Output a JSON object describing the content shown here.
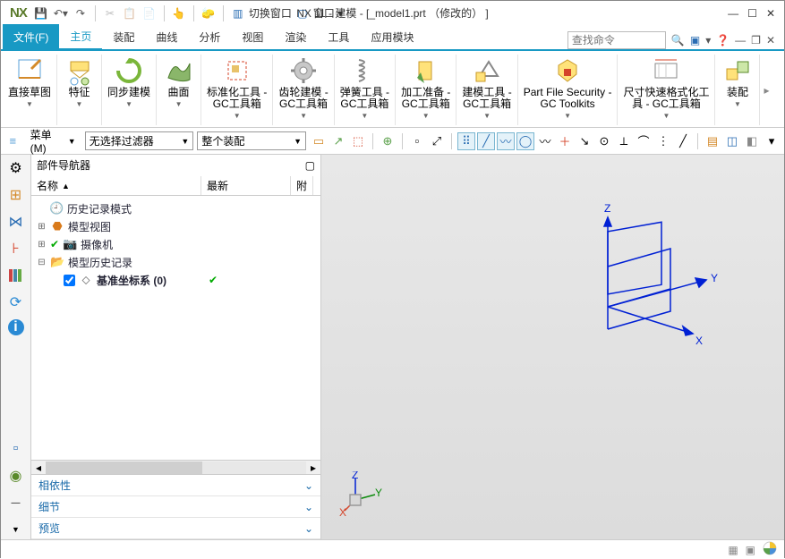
{
  "app": {
    "logo": "NX",
    "title": "NX 11 -  建模 - [_model1.prt （修改的） ]"
  },
  "titlebar_tools": {
    "switch_window": "切换窗口",
    "window_menu": "窗口"
  },
  "ribbon": {
    "file_tab": "文件(F)",
    "tabs": [
      "主页",
      "装配",
      "曲线",
      "分析",
      "视图",
      "渲染",
      "工具",
      "应用模块"
    ],
    "active_tab_index": 0,
    "search_placeholder": "查找命令",
    "groups": [
      {
        "label": "直接草图",
        "sub": ""
      },
      {
        "label": "特征",
        "sub": ""
      },
      {
        "label": "同步建模",
        "sub": ""
      },
      {
        "label": "曲面",
        "sub": ""
      },
      {
        "label": "标准化工具 -",
        "sub": "GC工具箱"
      },
      {
        "label": "齿轮建模 -",
        "sub": "GC工具箱"
      },
      {
        "label": "弹簧工具 -",
        "sub": "GC工具箱"
      },
      {
        "label": "加工准备 -",
        "sub": "GC工具箱"
      },
      {
        "label": "建模工具 -",
        "sub": "GC工具箱"
      },
      {
        "label": "Part File Security -",
        "sub": "GC Toolkits"
      },
      {
        "label": "尺寸快速格式化工",
        "sub": "具 - GC工具箱"
      },
      {
        "label": "装配",
        "sub": ""
      }
    ]
  },
  "toolbar2": {
    "menu_label": "菜单(M)",
    "filter_combo": "无选择过滤器",
    "assembly_combo": "整个装配"
  },
  "navigator": {
    "title": "部件导航器",
    "columns": {
      "name": "名称",
      "latest": "最新",
      "attr": "附"
    },
    "rows": [
      {
        "indent": 0,
        "expander": "",
        "icon": "🕘",
        "label": "历史记录模式",
        "check": false,
        "latest": ""
      },
      {
        "indent": 0,
        "expander": "+",
        "icon": "🟧",
        "label": "模型视图",
        "check": false,
        "latest": "",
        "icon_color": "#d97a1a"
      },
      {
        "indent": 0,
        "expander": "+",
        "icon": "📷",
        "label": "摄像机",
        "check": false,
        "pre": "✔",
        "latest": ""
      },
      {
        "indent": 0,
        "expander": "−",
        "icon": "📂",
        "label": "模型历史记录",
        "check": false,
        "latest": ""
      },
      {
        "indent": 1,
        "expander": "",
        "icon": "⬦",
        "label": "基准坐标系 (0)",
        "check": true,
        "latest": "✔",
        "bold": true
      }
    ],
    "accordions": [
      "相依性",
      "细节",
      "预览"
    ]
  },
  "axes": {
    "x": "X",
    "y": "Y",
    "z": "Z"
  }
}
